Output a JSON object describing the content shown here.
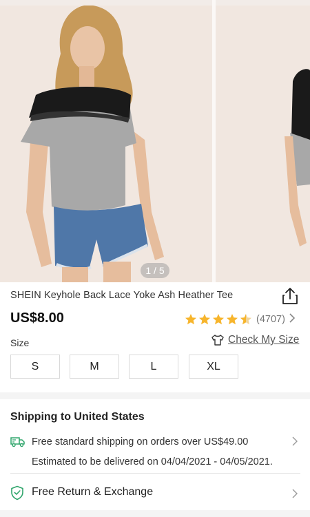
{
  "gallery": {
    "counter": "1 / 5",
    "slide_alt": "product-photo-model-in-grey-lace-tee-and-denim-shorts"
  },
  "product": {
    "title": "SHEIN Keyhole Back Lace Yoke Ash Heather Tee",
    "price": "US$8.00",
    "rating_stars": 4.5,
    "rating_count": "(4707)"
  },
  "size": {
    "label": "Size",
    "check_label": "Check My Size",
    "options": [
      "S",
      "M",
      "L",
      "XL"
    ]
  },
  "shipping": {
    "title": "Shipping to United States",
    "line1": "Free standard shipping on orders over US$49.00",
    "line2": "Estimated to be delivered on 04/04/2021 - 04/05/2021."
  },
  "returns": {
    "label": "Free Return & Exchange"
  },
  "colors": {
    "star": "#f7b52c",
    "accent_green": "#2fa56b",
    "background_beige": "#f1e7e0"
  }
}
